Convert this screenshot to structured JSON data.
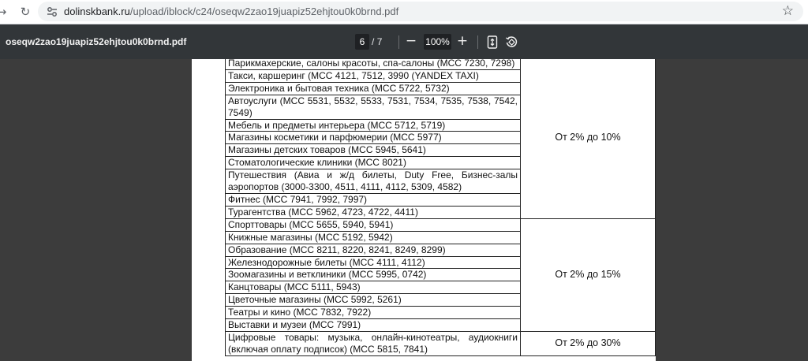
{
  "browser": {
    "back_icon": "arrow-left-icon",
    "reload_icon": "reload-icon",
    "site_info_icon": "tune-icon",
    "url_host": "dolinskbank.ru",
    "url_path": "/upload/iblock/c24/oseqw2zao19juapiz52ehjtou0k0brnd.pdf",
    "bookmark_icon": "star-icon"
  },
  "pdf_toolbar": {
    "title": "oseqw2zao19juapiz52ehjtou0k0brnd.pdf",
    "current_page": "6",
    "page_separator": "/",
    "total_pages": "7",
    "zoom_out_label": "−",
    "zoom": "100%",
    "zoom_in_label": "+",
    "fit_icon": "fit-page-icon",
    "rotate_icon": "rotate-icon"
  },
  "table": {
    "groups": [
      {
        "rate": "От 2% до 10%",
        "rows": [
          "Парикмахерские, салоны красоты, спа-салоны (МСС 7230, 7298)",
          "Такси, каршеринг (МСС 4121, 7512, 3990 (YANDEX TAXI)",
          "Электроника и бытовая техника (МСС 5722, 5732)",
          "Автоуслуги (МСС 5531, 5532, 5533, 7531, 7534, 7535, 7538, 7542, 7549)",
          "Мебель и предметы интерьера (МСС 5712, 5719)",
          "Магазины косметики и парфюмерии (МСС 5977)",
          "Магазины детских товаров (МСС 5945, 5641)",
          "Стоматологические клиники (МСС 8021)",
          "Путешествия (Авиа и ж/д билеты, Duty Free, Бизнес-залы аэропортов (3000-3300, 4511, 4111, 4112, 5309, 4582)",
          "Фитнес (МСС 7941, 7992, 7997)",
          "Турагентства (МСС 5962, 4723, 4722, 4411)"
        ]
      },
      {
        "rate": "От 2% до 15%",
        "rows": [
          "Спорттовары (МСС 5655, 5940, 5941)",
          "Книжные магазины (МСС 5192, 5942)",
          "Образование (МСС 8211, 8220, 8241, 8249, 8299)",
          "Железнодорожные билеты (МСС 4111, 4112)",
          "Зоомагазины и ветклиники (МСС 5995, 0742)",
          "Канцтовары (МСС 5111, 5943)",
          "Цветочные магазины (МСС 5992, 5261)",
          "Театры и кино (МСС 7832, 7922)",
          "Выставки и музеи (МСС 7991)"
        ]
      },
      {
        "rate": "От 2% до 30%",
        "rows": [
          "Цифровые товары: музыка, онлайн-кинотеатры, аудиокниги (включая оплату подписок) (МСС 5815, 7841)"
        ]
      }
    ]
  }
}
